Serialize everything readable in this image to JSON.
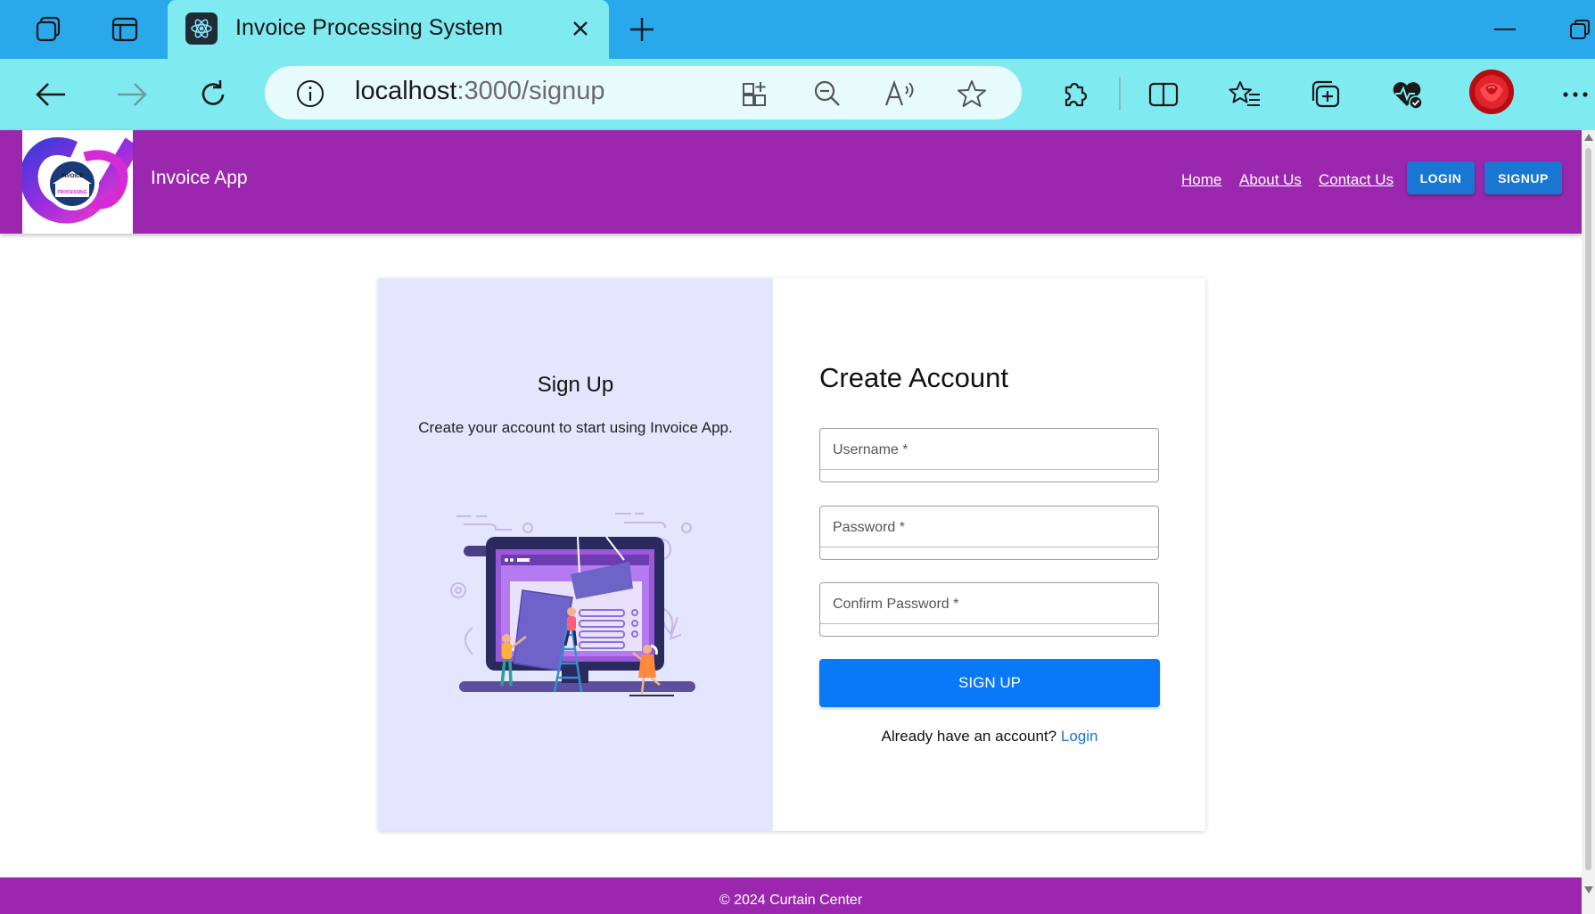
{
  "browser": {
    "tab_title": "Invoice Processing System",
    "url_host": "localhost",
    "url_path": ":3000/signup"
  },
  "header": {
    "app_title": "Invoice App",
    "logo_text_top": "INVOICE",
    "logo_text_bottom": "PROCESSING",
    "nav": {
      "home": "Home",
      "about": "About Us",
      "contact": "Contact Us"
    },
    "login_button": "LOGIN",
    "signup_button": "SIGNUP"
  },
  "left_panel": {
    "title": "Sign Up",
    "subtitle": "Create your account to start using Invoice App."
  },
  "form": {
    "title": "Create Account",
    "username_label": "Username *",
    "password_label": "Password *",
    "confirm_label": "Confirm Password *",
    "submit_label": "SIGN UP",
    "have_account_text": "Already have an account?",
    "login_link": "Login"
  },
  "footer": {
    "text": "© 2024 Curtain Center"
  },
  "colors": {
    "header_bg": "#9b27af",
    "primary_button": "#1976d2",
    "signup_button": "#0a79f7",
    "left_panel_bg": "#e3e6fd",
    "tabbar_bg": "#29a8eb",
    "toolbar_bg": "#7feaf0"
  }
}
